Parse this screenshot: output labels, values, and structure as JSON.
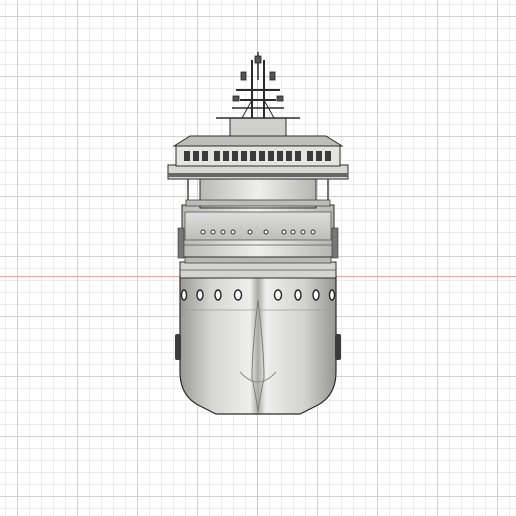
{
  "viewport": {
    "view": "front",
    "grid": true,
    "colors": {
      "background": "#ffffff",
      "grid_major": "#d3d3d3",
      "grid_minor": "#ececec",
      "axis_x": "#f2a3a3",
      "axis_y": "#a8dcb0"
    }
  },
  "model": {
    "name": "",
    "colors": {
      "hull_light": "#ececea",
      "hull_mid": "#c9c9c6",
      "hull_dark": "#8f8f8b",
      "outline": "#2b2b2b",
      "window": "#3a3a3a"
    }
  }
}
